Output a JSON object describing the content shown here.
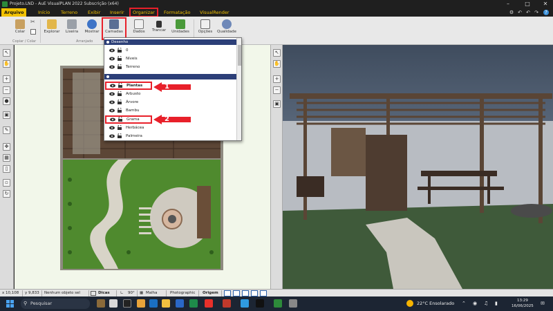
{
  "window": {
    "title": "Projeto.LND - AuE VisualPLAN 2022 Subscrição (x64)"
  },
  "ribbon_tabs": [
    {
      "label": "Arquivo"
    },
    {
      "label": "Início"
    },
    {
      "label": "Terreno"
    },
    {
      "label": "Exibir"
    },
    {
      "label": "Inserir"
    },
    {
      "label": "Organizar"
    },
    {
      "label": "Formatação"
    },
    {
      "label": "VisualRender"
    }
  ],
  "ribbon": {
    "buttons": [
      {
        "label": "Colar"
      },
      {
        "label": "Explorar"
      },
      {
        "label": "Lixeira"
      },
      {
        "label": "Mostrar"
      },
      {
        "label": "Camadas"
      },
      {
        "label": "Dados"
      },
      {
        "label": "Trancar"
      },
      {
        "label": "Unidades"
      },
      {
        "label": "Opções"
      },
      {
        "label": "Qualidade"
      }
    ],
    "groups": [
      {
        "label": "Copiar / Colar"
      },
      {
        "label": "Arranjado"
      }
    ]
  },
  "layers_panel": {
    "group1_title": "Desenho",
    "group1_items": [
      {
        "name": "0"
      },
      {
        "name": "Níveis"
      },
      {
        "name": "Terreno"
      }
    ],
    "group2_items": [
      {
        "name": "Plantas"
      },
      {
        "name": "Arbusto"
      },
      {
        "name": "Árvore"
      },
      {
        "name": "Bambu"
      },
      {
        "name": "Grama"
      },
      {
        "name": "Herbácea"
      },
      {
        "name": "Palmeira"
      }
    ],
    "callout_1": "1",
    "callout_2": "2"
  },
  "statusbar": {
    "x": "x 10,108",
    "y": "y 9,833",
    "selection": "Nenhum objeto sel",
    "tips": "Dicas",
    "angle": "90°",
    "grid": "Malha",
    "render": "Photographic",
    "origin": "Origem"
  },
  "taskbar": {
    "search_placeholder": "Pesquisar",
    "weather": "22°C  Ensolarado",
    "time": "13:29",
    "date": "16/06/2025"
  },
  "colors": {
    "accent_yellow": "#f2c200",
    "highlight_red": "#e8202a",
    "panel_header": "#2c3f78"
  }
}
